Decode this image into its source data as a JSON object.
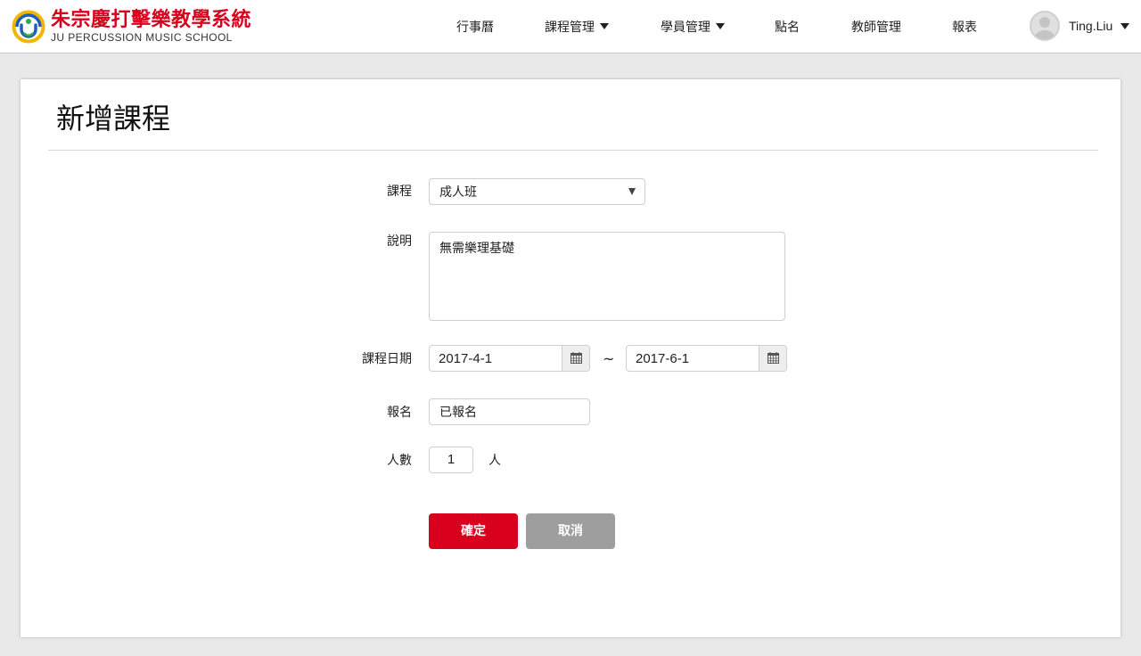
{
  "header": {
    "logo_title": "朱宗慶打擊樂教學系統",
    "logo_subtitle": "JU PERCUSSION MUSIC SCHOOL",
    "nav": [
      {
        "label": "行事曆",
        "dropdown": false
      },
      {
        "label": "課程管理",
        "dropdown": true
      },
      {
        "label": "學員管理",
        "dropdown": true
      },
      {
        "label": "點名",
        "dropdown": false
      },
      {
        "label": "教師管理",
        "dropdown": false
      },
      {
        "label": "報表",
        "dropdown": false
      }
    ],
    "user_name": "Ting.Liu"
  },
  "form": {
    "title": "新增課程",
    "course_label": "課程",
    "course_value": "成人班",
    "description_label": "說明",
    "description_value": "無需樂理基礎",
    "date_label": "課程日期",
    "date_start": "2017-4-1",
    "date_separator": "~",
    "date_end": "2017-6-1",
    "signup_label": "報名",
    "signup_value": "已報名",
    "count_label": "人數",
    "count_value": "1",
    "count_unit": "人",
    "confirm_label": "確定",
    "cancel_label": "取消"
  },
  "colors": {
    "brand_red": "#d8001c",
    "cancel_gray": "#9e9e9e",
    "page_bg": "#e9e9e9"
  },
  "icons": {
    "calendar": "calendar-icon",
    "avatar": "user-avatar-icon",
    "dropdown": "caret-down-icon"
  }
}
